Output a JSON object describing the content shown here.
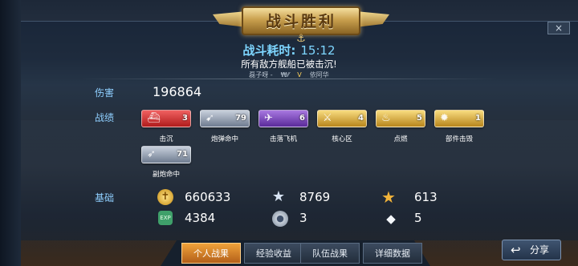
{
  "header": {
    "title": "战斗胜利",
    "duration_label": "战斗耗时:",
    "duration_value": "15:12",
    "result_message": "所有敌方舰船已被击沉!",
    "player_left": "磊子呀 -",
    "player_left_tag": "₩⁄⁄",
    "vs": "V",
    "player_right": "依阿华",
    "close_symbol": "×"
  },
  "damage": {
    "label": "伤害",
    "value": "196864"
  },
  "achievements": {
    "label": "战绩",
    "items": [
      {
        "label": "击沉",
        "count": "3",
        "color": "#d83232",
        "icon": "ship-sunk-icon"
      },
      {
        "label": "炮弹命中",
        "count": "79",
        "color": "#8a96a8",
        "icon": "shell-hit-icon"
      },
      {
        "label": "击落飞机",
        "count": "6",
        "color": "#7a3ec0",
        "icon": "plane-down-icon"
      },
      {
        "label": "核心区",
        "count": "4",
        "color": "#d8a82a",
        "icon": "core-hit-icon"
      },
      {
        "label": "点燃",
        "count": "5",
        "color": "#d8a82a",
        "icon": "fire-icon"
      },
      {
        "label": "部件击毁",
        "count": "1",
        "color": "#d8a82a",
        "icon": "part-destroy-icon"
      },
      {
        "label": "副炮命中",
        "count": "71",
        "color": "#8a96a8",
        "icon": "secondary-hit-icon"
      }
    ]
  },
  "base": {
    "label": "基础",
    "stats": [
      {
        "icon": "gold-coin-icon",
        "value": "660633"
      },
      {
        "icon": "star-icon",
        "value": "8769"
      },
      {
        "icon": "gold-star-icon",
        "value": "613"
      },
      {
        "icon": "exp-badge-icon",
        "value": "4384"
      },
      {
        "icon": "silver-medal-icon",
        "value": "3"
      },
      {
        "icon": "diamond-icon",
        "value": "5"
      }
    ]
  },
  "tabs": [
    "个人战果",
    "经验收益",
    "队伍战果",
    "详细数据"
  ],
  "active_tab": 0,
  "share_button": "分享"
}
